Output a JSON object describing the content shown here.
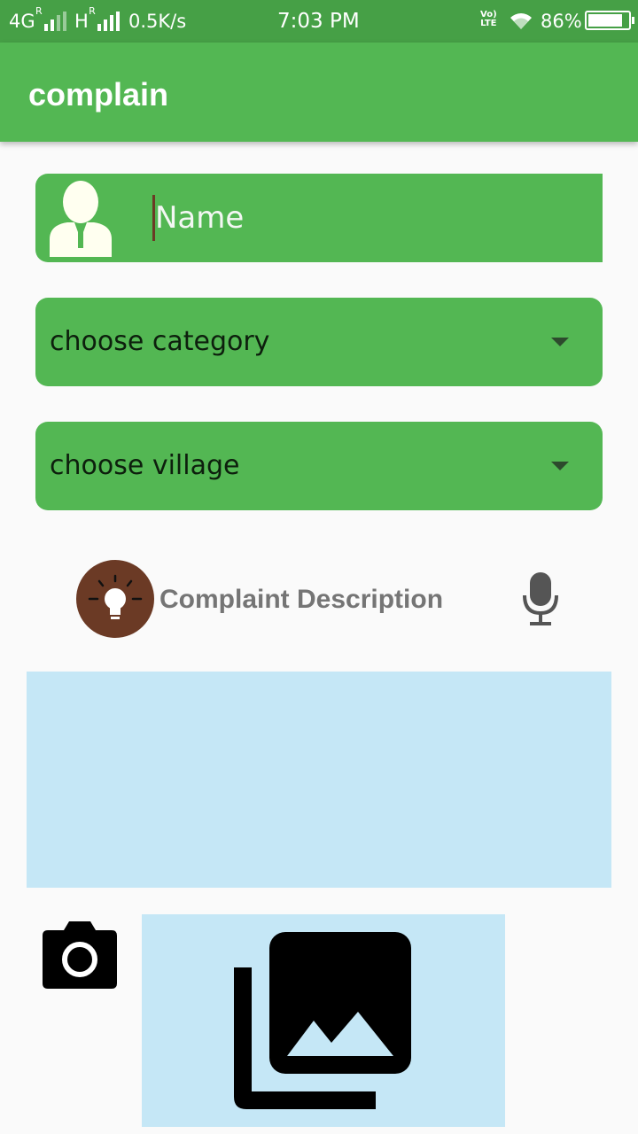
{
  "status_bar": {
    "network1": "4G",
    "network1_sup": "R",
    "network2": "H",
    "network2_sup": "R",
    "speed": "0.5K/s",
    "time": "7:03 PM",
    "volte_top": "Vo)",
    "volte_bottom": "LTE",
    "battery": "86%",
    "battery_level": 0.86
  },
  "app_bar": {
    "title": "complain"
  },
  "form": {
    "name_placeholder": "Name",
    "category_label": "choose category",
    "village_label": "choose village",
    "description_label": "Complaint Description",
    "description_value": ""
  },
  "icons": {
    "person": "person-icon",
    "bulb": "lightbulb-icon",
    "mic": "microphone-icon",
    "camera": "camera-icon",
    "gallery": "photo-library-icon",
    "dropdown": "chevron-down-icon"
  },
  "colors": {
    "primary": "#53b753",
    "status_bar": "#46a046",
    "field_bg": "#c5e7f6",
    "bulb_bg": "#6b3a25"
  }
}
